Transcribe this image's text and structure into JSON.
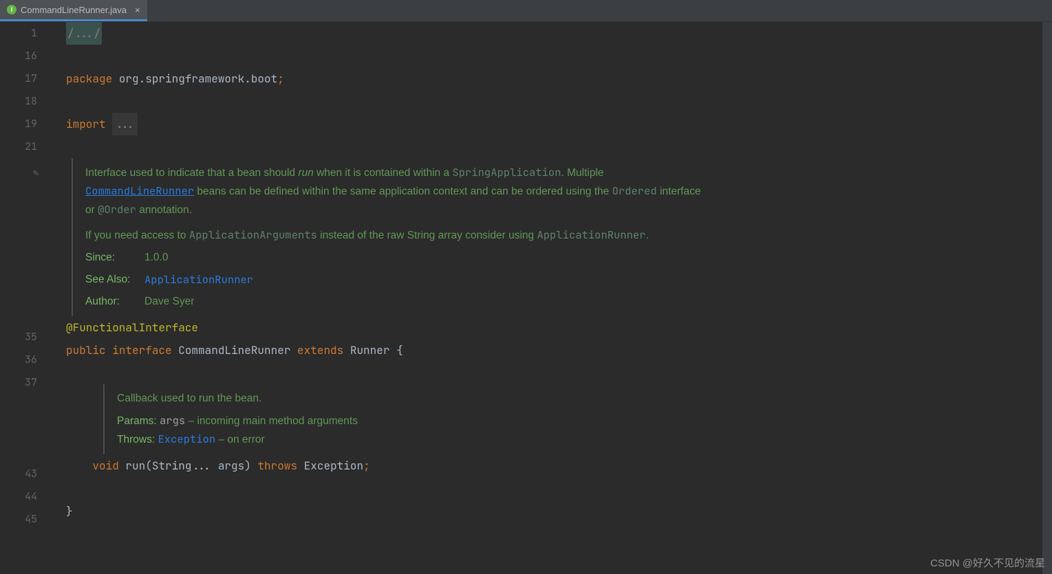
{
  "tab": {
    "title": "CommandLineRunner.java",
    "icon": "I"
  },
  "gutter": {
    "lines": [
      "1",
      "16",
      "17",
      "18",
      "19",
      "21",
      "",
      "35",
      "36",
      "37",
      "",
      "43",
      "44",
      "45"
    ],
    "edit_icon_row": 6,
    "impl_icons": [
      8,
      11
    ]
  },
  "code": {
    "fold_comment": "/.../",
    "package_kw": "package",
    "package_val": "org.springframework.boot",
    "import_kw": "import",
    "import_dots": "...",
    "ann": "@FunctionalInterface",
    "decl_public": "public",
    "decl_interface": "interface",
    "decl_name": "CommandLineRunner",
    "decl_extends": "extends",
    "decl_super": "Runner",
    "decl_open": "{",
    "method_void": "void",
    "method_name": "run",
    "method_params": "(String... args)",
    "method_throws": "throws",
    "method_exc": "Exception",
    "close_brace": "}"
  },
  "doc": {
    "p1a": "Interface used to indicate that a bean should ",
    "p1_em": "run",
    "p1b": " when it is contained within a ",
    "p1_link1": "SpringApplication",
    "p1c": ". Multiple ",
    "p1_link2": "CommandLineRunner",
    "p1d": " beans can be defined within the same application context and can be ordered using the ",
    "p1_link3": "Ordered",
    "p1e": " interface or ",
    "p1_link4": "@Order",
    "p1f": " annotation.",
    "p2a": "If you need access to ",
    "p2_link1": "ApplicationArguments",
    "p2b": " instead of the raw String array consider using ",
    "p2_link2": "ApplicationRunner",
    "p2c": ".",
    "since_label": "Since:",
    "since_val": "1.0.0",
    "see_label": "See Also:",
    "see_val": "ApplicationRunner",
    "author_label": "Author:",
    "author_val": "Dave Syer"
  },
  "inner_doc": {
    "summary": "Callback used to run the bean.",
    "params_label": "Params:",
    "params_name": "args",
    "params_desc": " – incoming main method arguments",
    "throws_label": "Throws:",
    "throws_name": "Exception",
    "throws_desc": " – on error"
  },
  "watermark": "CSDN @好久不见的流星"
}
